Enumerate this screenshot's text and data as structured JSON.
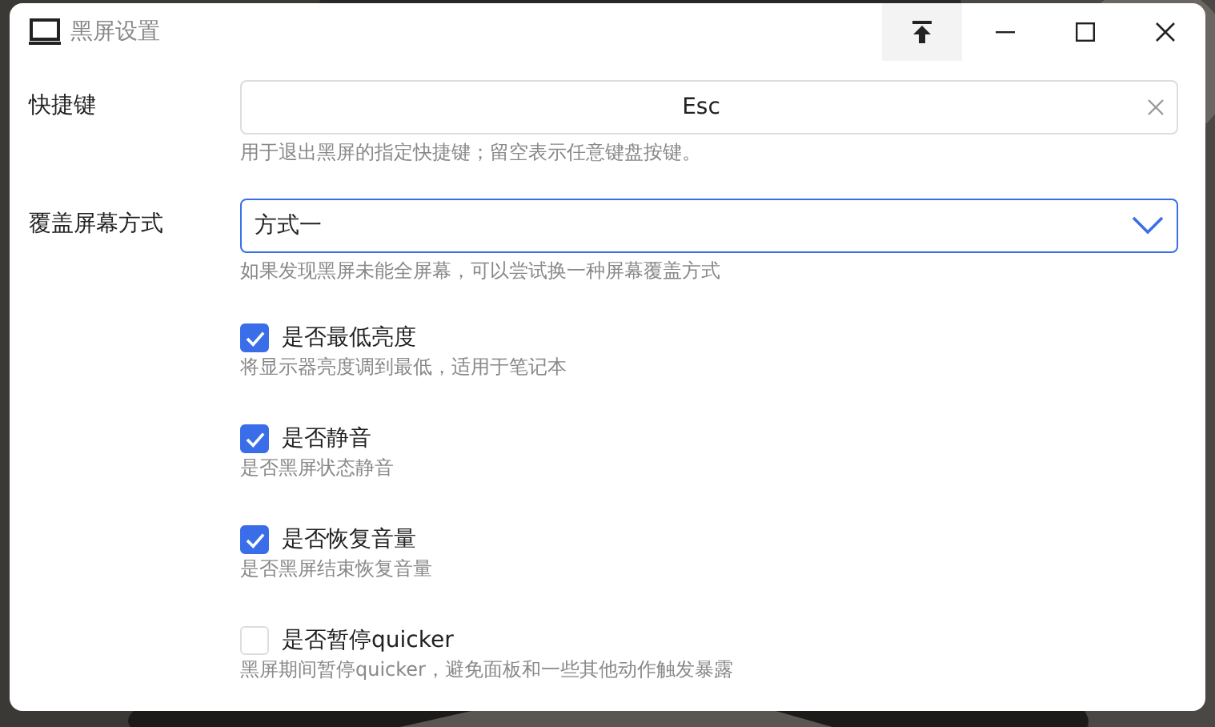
{
  "window": {
    "title": "黑屏设置"
  },
  "shortcut": {
    "label": "快捷键",
    "value": "Esc",
    "hint": "用于退出黑屏的指定快捷键；留空表示任意键盘按键。"
  },
  "cover_mode": {
    "label": "覆盖屏幕方式",
    "value": "方式一",
    "hint": "如果发现黑屏未能全屏幕，可以尝试换一种屏幕覆盖方式"
  },
  "options": [
    {
      "label": "是否最低亮度",
      "hint": "将显示器亮度调到最低，适用于笔记本",
      "checked": true
    },
    {
      "label": "是否静音",
      "hint": "是否黑屏状态静音",
      "checked": true
    },
    {
      "label": "是否恢复音量",
      "hint": "是否黑屏结束恢复音量",
      "checked": true
    },
    {
      "label": "是否暂停quicker",
      "hint": "黑屏期间暂停quicker，避免面板和一些其他动作触发暴露",
      "checked": false
    }
  ]
}
